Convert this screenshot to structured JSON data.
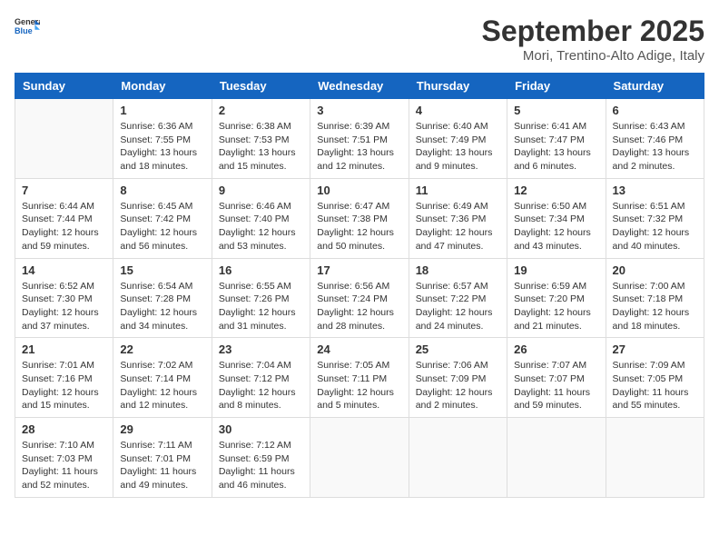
{
  "header": {
    "logo": {
      "general": "General",
      "blue": "Blue"
    },
    "title": "September 2025",
    "location": "Mori, Trentino-Alto Adige, Italy"
  },
  "weekdays": [
    "Sunday",
    "Monday",
    "Tuesday",
    "Wednesday",
    "Thursday",
    "Friday",
    "Saturday"
  ],
  "weeks": [
    [
      {
        "day": "",
        "info": ""
      },
      {
        "day": "1",
        "info": "Sunrise: 6:36 AM\nSunset: 7:55 PM\nDaylight: 13 hours\nand 18 minutes."
      },
      {
        "day": "2",
        "info": "Sunrise: 6:38 AM\nSunset: 7:53 PM\nDaylight: 13 hours\nand 15 minutes."
      },
      {
        "day": "3",
        "info": "Sunrise: 6:39 AM\nSunset: 7:51 PM\nDaylight: 13 hours\nand 12 minutes."
      },
      {
        "day": "4",
        "info": "Sunrise: 6:40 AM\nSunset: 7:49 PM\nDaylight: 13 hours\nand 9 minutes."
      },
      {
        "day": "5",
        "info": "Sunrise: 6:41 AM\nSunset: 7:47 PM\nDaylight: 13 hours\nand 6 minutes."
      },
      {
        "day": "6",
        "info": "Sunrise: 6:43 AM\nSunset: 7:46 PM\nDaylight: 13 hours\nand 2 minutes."
      }
    ],
    [
      {
        "day": "7",
        "info": "Sunrise: 6:44 AM\nSunset: 7:44 PM\nDaylight: 12 hours\nand 59 minutes."
      },
      {
        "day": "8",
        "info": "Sunrise: 6:45 AM\nSunset: 7:42 PM\nDaylight: 12 hours\nand 56 minutes."
      },
      {
        "day": "9",
        "info": "Sunrise: 6:46 AM\nSunset: 7:40 PM\nDaylight: 12 hours\nand 53 minutes."
      },
      {
        "day": "10",
        "info": "Sunrise: 6:47 AM\nSunset: 7:38 PM\nDaylight: 12 hours\nand 50 minutes."
      },
      {
        "day": "11",
        "info": "Sunrise: 6:49 AM\nSunset: 7:36 PM\nDaylight: 12 hours\nand 47 minutes."
      },
      {
        "day": "12",
        "info": "Sunrise: 6:50 AM\nSunset: 7:34 PM\nDaylight: 12 hours\nand 43 minutes."
      },
      {
        "day": "13",
        "info": "Sunrise: 6:51 AM\nSunset: 7:32 PM\nDaylight: 12 hours\nand 40 minutes."
      }
    ],
    [
      {
        "day": "14",
        "info": "Sunrise: 6:52 AM\nSunset: 7:30 PM\nDaylight: 12 hours\nand 37 minutes."
      },
      {
        "day": "15",
        "info": "Sunrise: 6:54 AM\nSunset: 7:28 PM\nDaylight: 12 hours\nand 34 minutes."
      },
      {
        "day": "16",
        "info": "Sunrise: 6:55 AM\nSunset: 7:26 PM\nDaylight: 12 hours\nand 31 minutes."
      },
      {
        "day": "17",
        "info": "Sunrise: 6:56 AM\nSunset: 7:24 PM\nDaylight: 12 hours\nand 28 minutes."
      },
      {
        "day": "18",
        "info": "Sunrise: 6:57 AM\nSunset: 7:22 PM\nDaylight: 12 hours\nand 24 minutes."
      },
      {
        "day": "19",
        "info": "Sunrise: 6:59 AM\nSunset: 7:20 PM\nDaylight: 12 hours\nand 21 minutes."
      },
      {
        "day": "20",
        "info": "Sunrise: 7:00 AM\nSunset: 7:18 PM\nDaylight: 12 hours\nand 18 minutes."
      }
    ],
    [
      {
        "day": "21",
        "info": "Sunrise: 7:01 AM\nSunset: 7:16 PM\nDaylight: 12 hours\nand 15 minutes."
      },
      {
        "day": "22",
        "info": "Sunrise: 7:02 AM\nSunset: 7:14 PM\nDaylight: 12 hours\nand 12 minutes."
      },
      {
        "day": "23",
        "info": "Sunrise: 7:04 AM\nSunset: 7:12 PM\nDaylight: 12 hours\nand 8 minutes."
      },
      {
        "day": "24",
        "info": "Sunrise: 7:05 AM\nSunset: 7:11 PM\nDaylight: 12 hours\nand 5 minutes."
      },
      {
        "day": "25",
        "info": "Sunrise: 7:06 AM\nSunset: 7:09 PM\nDaylight: 12 hours\nand 2 minutes."
      },
      {
        "day": "26",
        "info": "Sunrise: 7:07 AM\nSunset: 7:07 PM\nDaylight: 11 hours\nand 59 minutes."
      },
      {
        "day": "27",
        "info": "Sunrise: 7:09 AM\nSunset: 7:05 PM\nDaylight: 11 hours\nand 55 minutes."
      }
    ],
    [
      {
        "day": "28",
        "info": "Sunrise: 7:10 AM\nSunset: 7:03 PM\nDaylight: 11 hours\nand 52 minutes."
      },
      {
        "day": "29",
        "info": "Sunrise: 7:11 AM\nSunset: 7:01 PM\nDaylight: 11 hours\nand 49 minutes."
      },
      {
        "day": "30",
        "info": "Sunrise: 7:12 AM\nSunset: 6:59 PM\nDaylight: 11 hours\nand 46 minutes."
      },
      {
        "day": "",
        "info": ""
      },
      {
        "day": "",
        "info": ""
      },
      {
        "day": "",
        "info": ""
      },
      {
        "day": "",
        "info": ""
      }
    ]
  ]
}
